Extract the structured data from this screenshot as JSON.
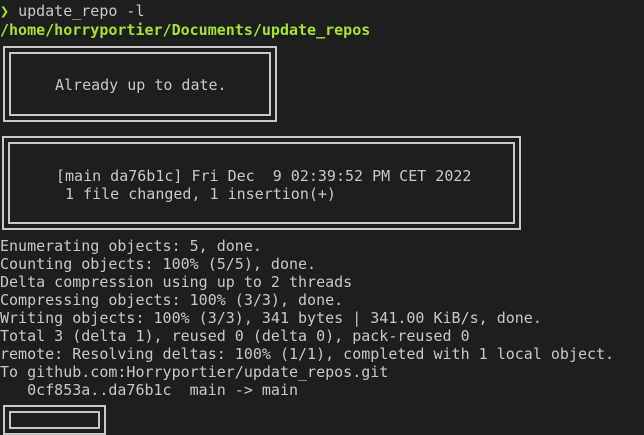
{
  "terminal": {
    "prompt_symbol": "❯",
    "command": "update_repo -l",
    "cwd": "/home/horryportier/Documents/update_repos",
    "box1": "Already up to date.",
    "box2_line1": "[main da76b1c] Fri Dec  9 02:39:52 PM CET 2022",
    "box2_line2": " 1 file changed, 1 insertion(+)",
    "output": [
      "Enumerating objects: 5, done.",
      "Counting objects: 100% (5/5), done.",
      "Delta compression using up to 2 threads",
      "Compressing objects: 100% (3/3), done.",
      "Writing objects: 100% (3/3), 341 bytes | 341.00 KiB/s, done.",
      "Total 3 (delta 1), reused 0 (delta 0), pack-reused 0",
      "remote: Resolving deltas: 100% (1/1), completed with 1 local object.",
      "To github.com:Horryportier/update_repos.git",
      "   0cf853a..da76b1c  main -> main"
    ]
  }
}
